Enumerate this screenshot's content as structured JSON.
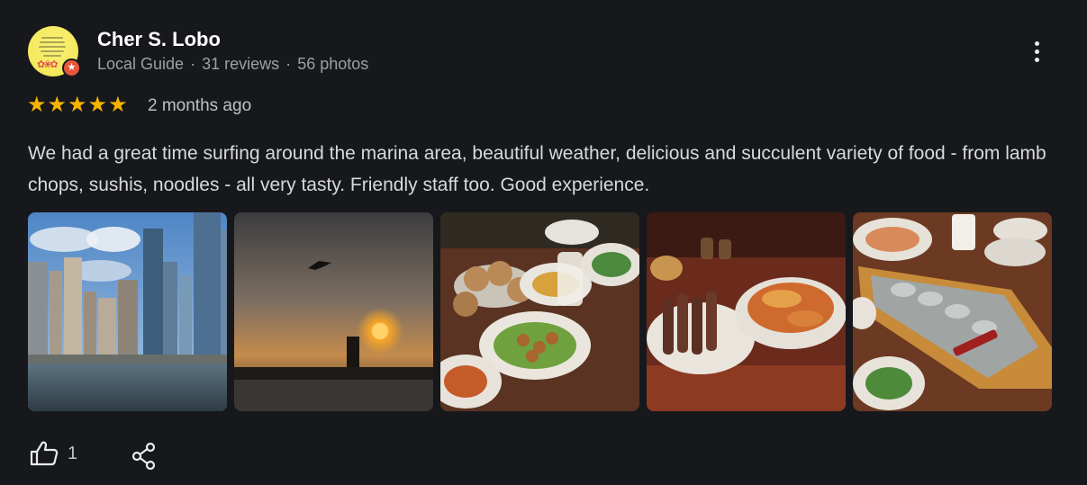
{
  "reviewer": {
    "name": "Cher S. Lobo",
    "role": "Local Guide",
    "reviews": "31 reviews",
    "photos": "56 photos",
    "separator": "·"
  },
  "rating": {
    "stars": 5,
    "time": "2 months ago"
  },
  "review": {
    "text": "We had a great time surfing around the marina area, beautiful weather, delicious and succulent variety of food - from lamb chops, sushis, noodles - all very tasty. Friendly staff too. Good experience."
  },
  "photos": [
    {
      "icon": "marina-skyline-photo"
    },
    {
      "icon": "sunset-photo"
    },
    {
      "icon": "food-buffet-photo"
    },
    {
      "icon": "lamb-chops-photo"
    },
    {
      "icon": "seafood-boat-photo"
    }
  ],
  "actions": {
    "like_count": "1",
    "like_icon": "thumbs-up-icon",
    "share_icon": "share-icon",
    "more_icon": "more-vert-icon"
  },
  "colors": {
    "background": "#17181c",
    "star": "#f4b400",
    "badge": "#e8573b"
  }
}
